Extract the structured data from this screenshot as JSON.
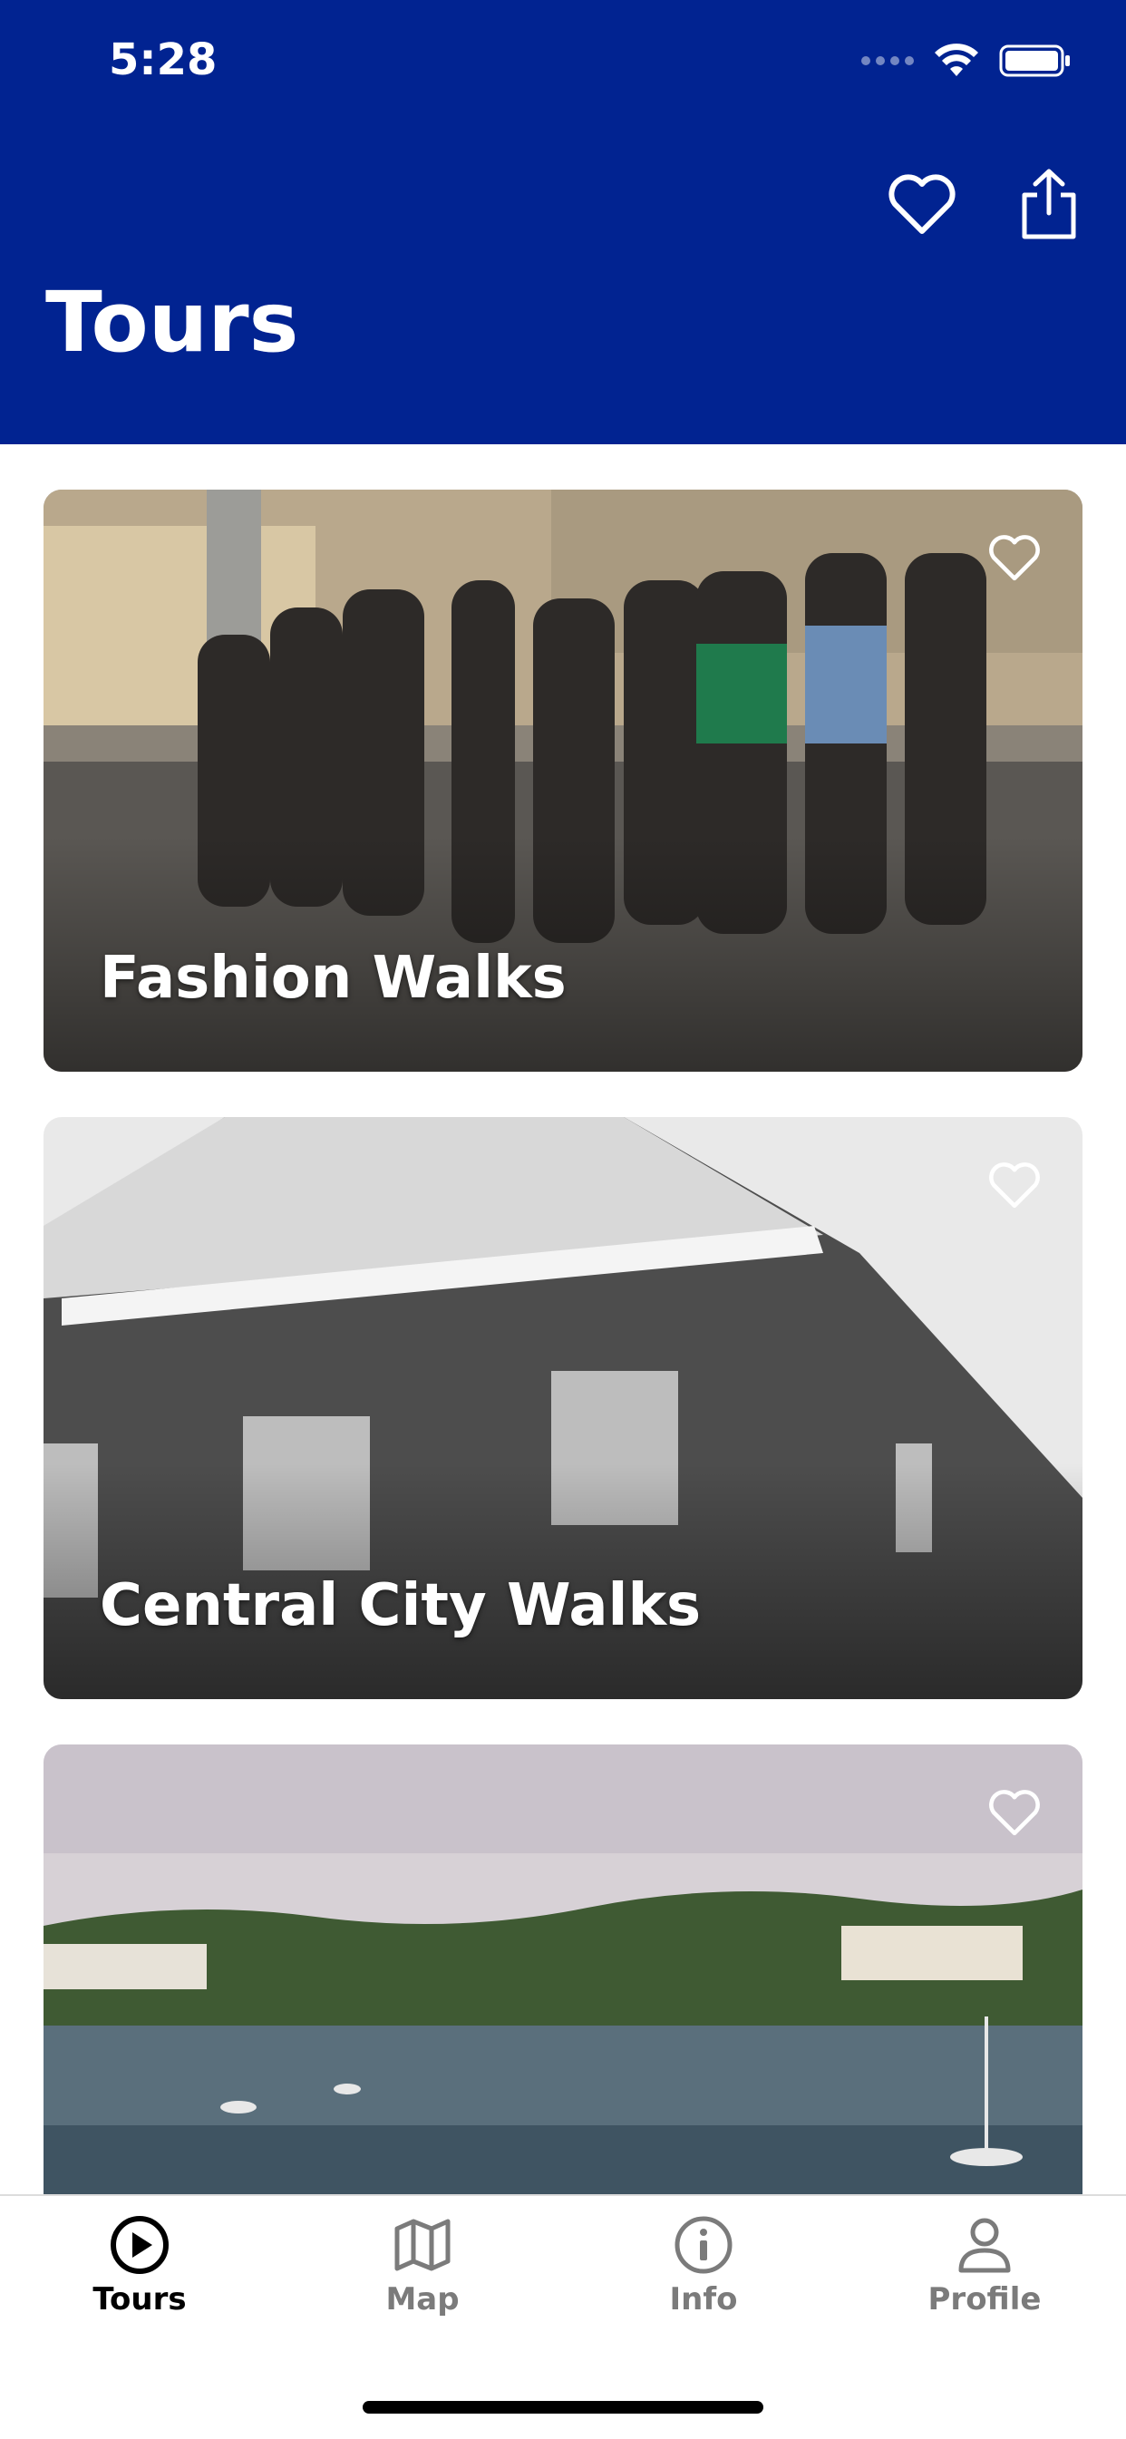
{
  "status": {
    "time": "5:28"
  },
  "header": {
    "title": "Tours"
  },
  "cards": [
    {
      "title": "Fashion Walks"
    },
    {
      "title": "Central City Walks"
    },
    {
      "title": ""
    }
  ],
  "tabs": [
    {
      "label": "Tours",
      "icon": "play-circle-icon",
      "active": true
    },
    {
      "label": "Map",
      "icon": "map-icon",
      "active": false
    },
    {
      "label": "Info",
      "icon": "info-icon",
      "active": false
    },
    {
      "label": "Profile",
      "icon": "profile-icon",
      "active": false
    }
  ],
  "colors": {
    "header_bg": "#012391",
    "active_tab": "#000000",
    "inactive_tab": "#7b7b7b"
  }
}
